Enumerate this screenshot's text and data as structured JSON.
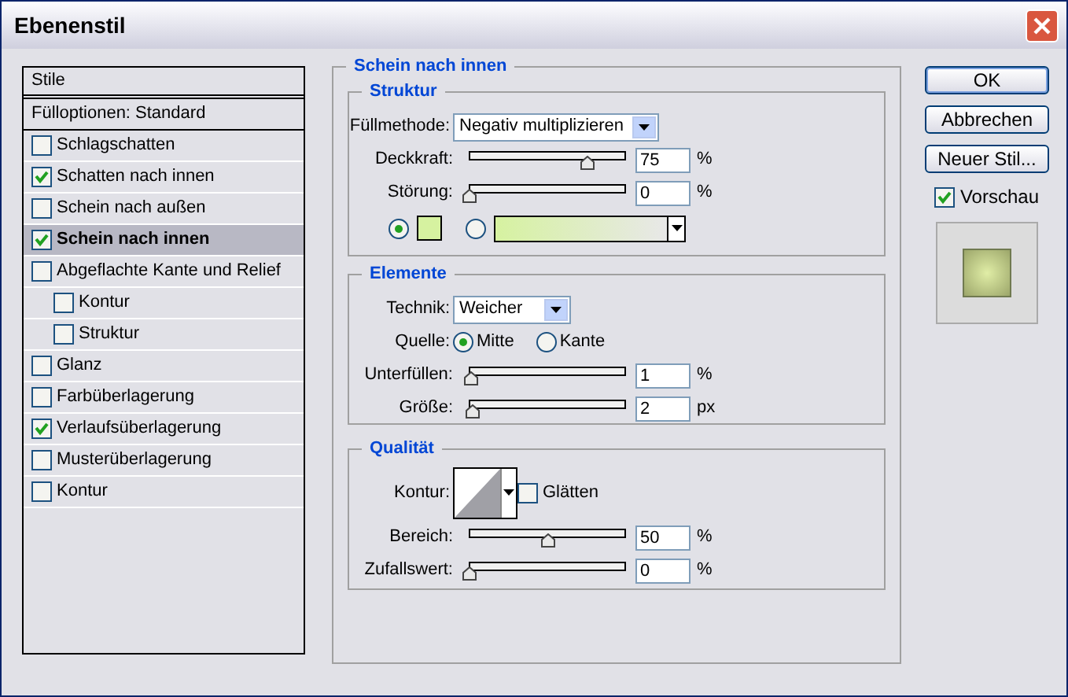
{
  "window": {
    "title": "Ebenenstil"
  },
  "styles": {
    "header": "Stile",
    "blending_options": {
      "label": "Fülloptionen: Standard",
      "selected": false
    },
    "items": [
      {
        "label": "Schlagschatten",
        "checked": false,
        "selected": false
      },
      {
        "label": "Schatten nach innen",
        "checked": true,
        "selected": false
      },
      {
        "label": "Schein nach außen",
        "checked": false,
        "selected": false
      },
      {
        "label": "Schein nach innen",
        "checked": true,
        "selected": true
      },
      {
        "label": "Abgeflachte Kante und Relief",
        "checked": false,
        "selected": false,
        "children": [
          {
            "label": "Kontur",
            "checked": false,
            "selected": false
          },
          {
            "label": "Struktur",
            "checked": false,
            "selected": false
          }
        ]
      },
      {
        "label": "Glanz",
        "checked": false,
        "selected": false
      },
      {
        "label": "Farbüberlagerung",
        "checked": false,
        "selected": false
      },
      {
        "label": "Verlaufsüberlagerung",
        "checked": true,
        "selected": false
      },
      {
        "label": "Musterüberlagerung",
        "checked": false,
        "selected": false
      },
      {
        "label": "Kontur",
        "checked": false,
        "selected": false
      }
    ]
  },
  "panel": {
    "title": "Schein nach innen",
    "structure": {
      "title": "Struktur",
      "blend_mode": {
        "label": "Füllmethode:",
        "value": "Negativ multiplizieren"
      },
      "sliders": [
        {
          "label": "Deckkraft:",
          "level": 0.75,
          "value": "75",
          "unit": "%"
        },
        {
          "label": "Störung:",
          "level": 0,
          "value": "0",
          "unit": "%"
        }
      ],
      "fill": [
        {
          "kind": "color",
          "selected": true,
          "color": "#d6f2a0"
        },
        {
          "kind": "gradient",
          "selected": false,
          "color": "#d6f2a0"
        }
      ]
    },
    "elements": {
      "title": "Elemente",
      "technique": {
        "label": "Technik:",
        "value": "Weicher"
      },
      "source": {
        "label": "Quelle:",
        "options": [
          {
            "label": "Mitte",
            "selected": true
          },
          {
            "label": "Kante",
            "selected": false
          }
        ]
      },
      "sliders": [
        {
          "label": "Unterfüllen:",
          "level": 0.01,
          "value": "1",
          "unit": "%"
        },
        {
          "label": "Größe:",
          "level": 0.02,
          "value": "2",
          "unit": "px"
        }
      ]
    },
    "quality": {
      "title": "Qualität",
      "contour_label": "Kontur:",
      "anti_alias": {
        "label": "Glätten",
        "checked": false
      },
      "sliders": [
        {
          "label": "Bereich:",
          "level": 0.5,
          "value": "50",
          "unit": "%"
        },
        {
          "label": "Zufallswert:",
          "level": 0,
          "value": "0",
          "unit": "%"
        }
      ]
    }
  },
  "buttons": [
    {
      "label": "OK",
      "default": true
    },
    {
      "label": "Abbrechen",
      "default": false
    },
    {
      "label": "Neuer Stil...",
      "default": false
    }
  ],
  "preview": {
    "label": "Vorschau",
    "checked": true
  }
}
